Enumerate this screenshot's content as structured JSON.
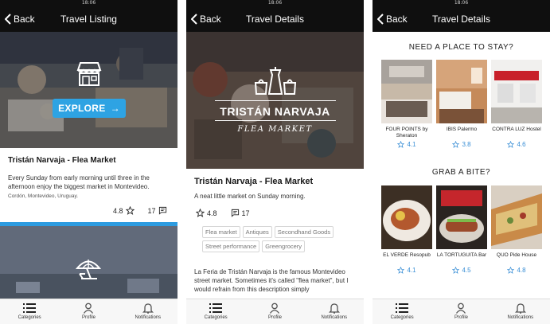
{
  "status_bar": {
    "time": "18:06"
  },
  "screens": {
    "listing": {
      "back_label": "Back",
      "title": "Travel Listing",
      "explore_label": "EXPLORE",
      "explore_arrow": "→",
      "card": {
        "title": "Tristán Narvaja - Flea Market",
        "description": "Every Sunday from early morning until three in the afternoon enjoy the biggest market in Montevideo.",
        "location": "Cordón, Montevideo, Uruguay.",
        "rating": "4.8",
        "comments": "17"
      }
    },
    "details": {
      "back_label": "Back",
      "title": "Travel Details",
      "hero_title": "TRISTÁN NARVAJA",
      "hero_subtitle": "FLEA MARKET",
      "name": "Tristán Narvaja - Flea Market",
      "tagline": "A neat little market on Sunday morning.",
      "rating": "4.8",
      "comments": "17",
      "tags": [
        "Flea market",
        "Antiques",
        "Secondhand Goods",
        "Street performance",
        "Greengrocery"
      ],
      "body": "La Feria de Tristán Narvaja is the famous Montevideo street market. Sometimes it's called \"flea market\", but I would refrain from this description simply"
    },
    "places": {
      "back_label": "Back",
      "title": "Travel Details",
      "stay_heading": "NEED A PLACE TO STAY?",
      "bite_heading": "GRAB A BITE?",
      "hotels": [
        {
          "name": "FOUR POINTS by Sheraton",
          "rating": "4.1"
        },
        {
          "name": "IBIS Palermo",
          "rating": "3.8"
        },
        {
          "name": "CONTRA LUZ Hostel",
          "rating": "4.6"
        }
      ],
      "restaurants": [
        {
          "name": "EL VERDE Resopub",
          "rating": "4.1"
        },
        {
          "name": "LA TORTUGUITA Bar",
          "rating": "4.5"
        },
        {
          "name": "QUO Pide House",
          "rating": "4.8"
        }
      ]
    }
  },
  "tab_bar": {
    "categories": "Categories",
    "profile": "Profile",
    "notifications": "Notifications"
  },
  "icons": {
    "back": "chevron-left-icon",
    "store": "store-icon",
    "beach": "umbrella-icon",
    "star": "star-icon",
    "comment": "comment-icon",
    "categories": "list-icon",
    "profile": "user-icon",
    "notifications": "bell-icon"
  },
  "colors": {
    "accent": "#2ea3e3",
    "nav": "#0f0f0f",
    "rating": "#3a8fd6"
  }
}
